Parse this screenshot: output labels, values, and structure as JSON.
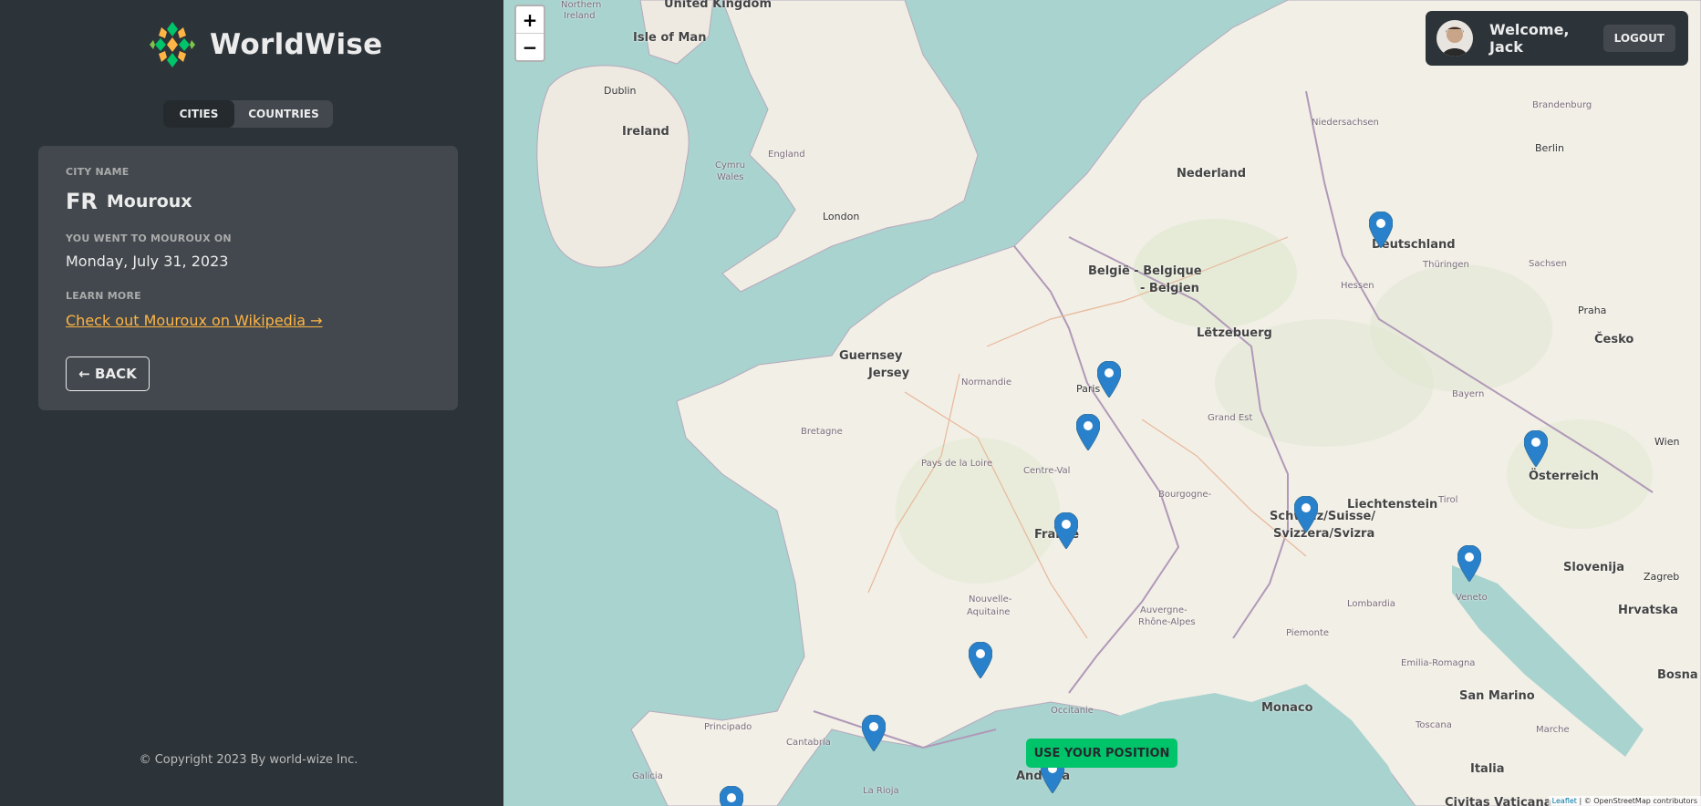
{
  "app": {
    "name": "WorldWise",
    "tabs": [
      {
        "label": "CITIES",
        "active": true
      },
      {
        "label": "COUNTRIES",
        "active": false
      }
    ]
  },
  "city": {
    "name_label": "CITY NAME",
    "flag": "FR",
    "name": "Mouroux",
    "date_label": "YOU WENT TO MOUROUX ON",
    "date": "Monday, July 31, 2023",
    "learn_label": "LEARN MORE",
    "wiki_link": "Check out Mouroux on Wikipedia →",
    "back_label": "← BACK"
  },
  "footer": {
    "copyright": "© Copyright 2023 By world-wize Inc."
  },
  "map": {
    "zoom_in": "+",
    "zoom_out": "−",
    "use_position": "USE YOUR POSITION",
    "attribution_leaflet": "Leaflet",
    "attribution_rest": "| © OpenStreetMap contributors",
    "labels": {
      "uk": "United Kingdom",
      "northern": "Northern",
      "ireland_n": "Ireland",
      "isle_of_man": "Isle of Man",
      "dublin": "Dublin",
      "ireland": "Ireland",
      "london": "London",
      "england": "England",
      "cymru": "Cymru",
      "wales": "Wales",
      "guernsey": "Guernsey",
      "jersey": "Jersey",
      "nederland": "Nederland",
      "belgie": "België - Belgique",
      "belgien": "- Belgien",
      "letzebuerg": "Lëtzebuerg",
      "deutschland": "Deutschland",
      "berlin": "Berlin",
      "praha": "Praha",
      "cesko": "Česko",
      "paris": "Paris",
      "france": "France",
      "normandie": "Normandie",
      "bretagne": "Bretagne",
      "pays_de_la_loire": "Pays de la Loire",
      "centre": "Centre-Val",
      "grand_est": "Grand Est",
      "bourgogne": "Bourgogne-",
      "nouvelle": "Nouvelle-",
      "aquitaine": "Aquitaine",
      "auvergne": "Auvergne-",
      "rhone": "Rhône-Alpes",
      "occitanie": "Occitanie",
      "schweiz": "Schweiz/Suisse/",
      "svizzera": "Svizzera/Svizra",
      "liechtenstein": "Liechtenstein",
      "osterreich": "Österreich",
      "wien": "Wien",
      "slovenija": "Slovenija",
      "zagreb": "Zagreb",
      "hrvatska": "Hrvatska",
      "bosna": "Bosna i H",
      "monaco": "Monaco",
      "san_marino": "San Marino",
      "italia": "Italia",
      "civitas": "Civitas Vaticana",
      "andorra": "Andorra",
      "galicia": "Galicia",
      "cantabria": "Cantabria",
      "principado": "Principado",
      "la_rioja": "La Rioja",
      "lombardia": "Lombardia",
      "veneto": "Veneto",
      "toscana": "Toscana",
      "emilia": "Emilia-Romagna",
      "piemonte": "Piemonte",
      "bayern": "Bayern",
      "hessen": "Hessen",
      "thuringen": "Thüringen",
      "sachsen": "Sachsen",
      "niedersachsen": "Niedersachsen",
      "brandenburg": "Brandenburg",
      "tirol": "Tirol",
      "marche": "Marche"
    }
  },
  "user": {
    "welcome": "Welcome, Jack",
    "logout": "LOGOUT"
  },
  "colors": {
    "sidebar_bg": "#2d3439",
    "card_bg": "#42484d",
    "accent_link": "#ffb545",
    "brand_green": "#00c46a",
    "marker_blue": "#2a81cb"
  }
}
